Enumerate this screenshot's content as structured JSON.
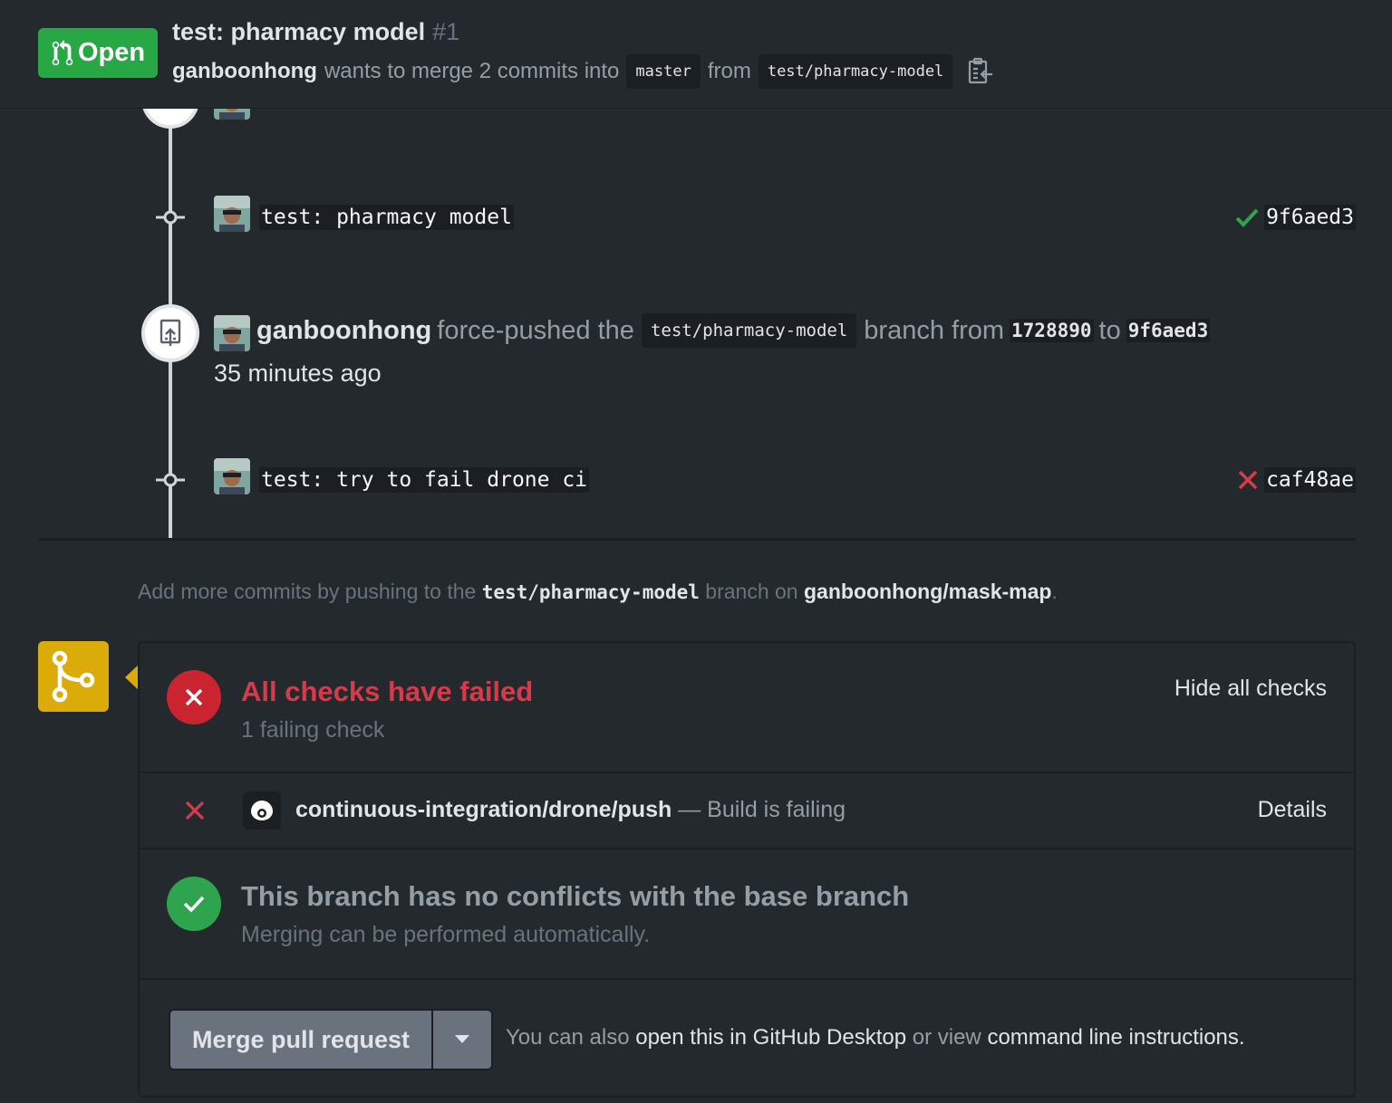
{
  "header": {
    "state": "Open",
    "title": "test: pharmacy model",
    "number": "#1",
    "author": "ganboonhong",
    "meta_text": "wants to merge 2 commits into",
    "base_branch": "master",
    "from_text": "from",
    "head_branch": "test/pharmacy-model"
  },
  "timeline": {
    "commit1": {
      "message": "test: pharmacy model",
      "sha": "9f6aed3",
      "status": "success"
    },
    "force_push": {
      "author": "ganboonhong",
      "action": "force-pushed the",
      "branch": "test/pharmacy-model",
      "from_label": "branch from",
      "from_sha": "1728890",
      "to_label": "to",
      "to_sha": "9f6aed3",
      "time": "35 minutes ago"
    },
    "commit2": {
      "message": "test: try to fail drone ci",
      "sha": "caf48ae",
      "status": "failure"
    }
  },
  "push_hint": {
    "prefix": "Add more commits by pushing to the",
    "branch": "test/pharmacy-model",
    "middle": "branch on",
    "repo": "ganboonhong/mask-map",
    "suffix": "."
  },
  "merge_box": {
    "checks_title": "All checks have failed",
    "checks_sub": "1 failing check",
    "hide_checks": "Hide all checks",
    "check_name": "continuous-integration/drone/push",
    "check_desc": "— Build is failing",
    "details": "Details",
    "noconf_title": "This branch has no conflicts with the base branch",
    "noconf_sub": "Merging can be performed automatically.",
    "merge_button": "Merge pull request",
    "hint_prefix": "You can also",
    "hint_open": "open this in GitHub Desktop",
    "hint_or": "or",
    "hint_view": "view",
    "hint_cli": "command line instructions",
    "hint_suffix": "."
  },
  "colors": {
    "open_green": "#28a745",
    "fail_red": "#d73a49",
    "success_green": "#2ea44f",
    "warning_yellow": "#dbab09",
    "background": "#24292e"
  }
}
